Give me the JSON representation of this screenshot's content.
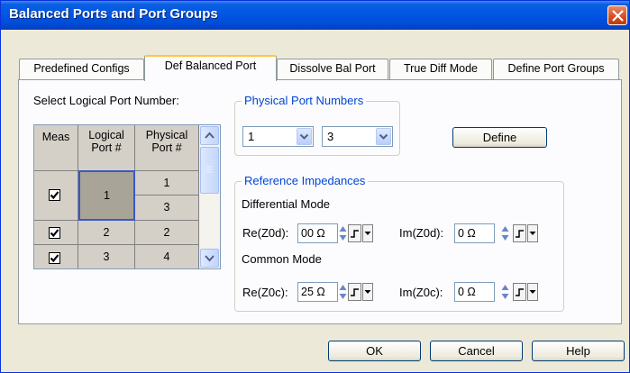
{
  "window": {
    "title": "Balanced Ports and Port Groups"
  },
  "tabs": [
    {
      "label": "Predefined Configs"
    },
    {
      "label": "Def Balanced Port"
    },
    {
      "label": "Dissolve Bal Port"
    },
    {
      "label": "True Diff Mode"
    },
    {
      "label": "Define Port Groups"
    }
  ],
  "select_label": "Select Logical Port Number:",
  "grid": {
    "headers": [
      "Meas",
      "Logical\nPort #",
      "Physical\nPort #"
    ],
    "rows": [
      {
        "meas": true,
        "logical": "1",
        "physical": [
          "1",
          "3"
        ],
        "selected": true
      },
      {
        "meas": true,
        "logical": "2",
        "physical": [
          "2"
        ]
      },
      {
        "meas": true,
        "logical": "3",
        "physical": [
          "4"
        ]
      }
    ]
  },
  "physical": {
    "legend": "Physical Port Numbers",
    "port_a": "1",
    "port_b": "3",
    "define_label": "Define"
  },
  "reference": {
    "legend": "Reference Impedances",
    "differential_label": "Differential Mode",
    "re_z0d_label": "Re(Z0d):",
    "re_z0d_value": "00 Ω",
    "im_z0d_label": "Im(Z0d):",
    "im_z0d_value": "0 Ω",
    "common_label": "Common Mode",
    "re_z0c_label": "Re(Z0c):",
    "re_z0c_value": "25 Ω",
    "im_z0c_label": "Im(Z0c):",
    "im_z0c_value": "0 Ω"
  },
  "footer": {
    "ok": "OK",
    "cancel": "Cancel",
    "help": "Help"
  },
  "colors": {
    "titlebar": "#0055e5",
    "accent_tab": "#ffc83c",
    "legend": "#0046d5"
  }
}
